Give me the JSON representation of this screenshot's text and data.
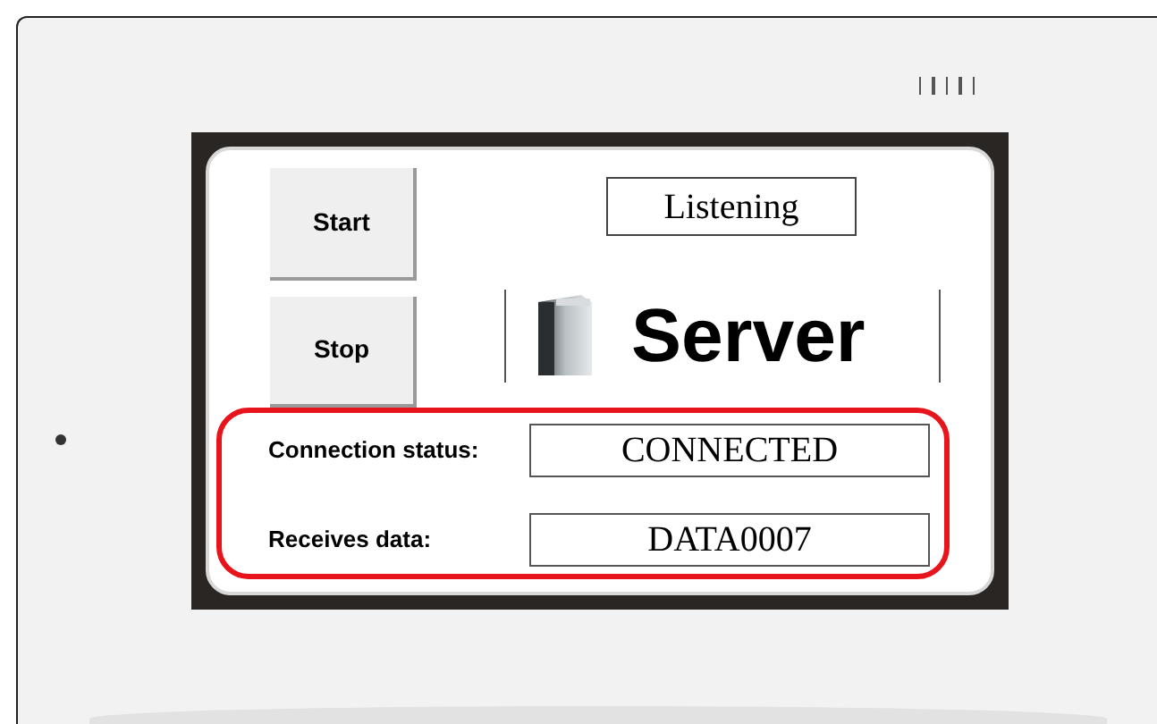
{
  "buttons": [
    {
      "label": "Start"
    },
    {
      "label": "Stop"
    }
  ],
  "status": "Listening",
  "logo": {
    "text": "Server"
  },
  "fields_highlighted": true,
  "fields": [
    {
      "label": "Connection status:",
      "value": "CONNECTED"
    },
    {
      "label": "Receives data:",
      "value": "DATA0007"
    }
  ]
}
